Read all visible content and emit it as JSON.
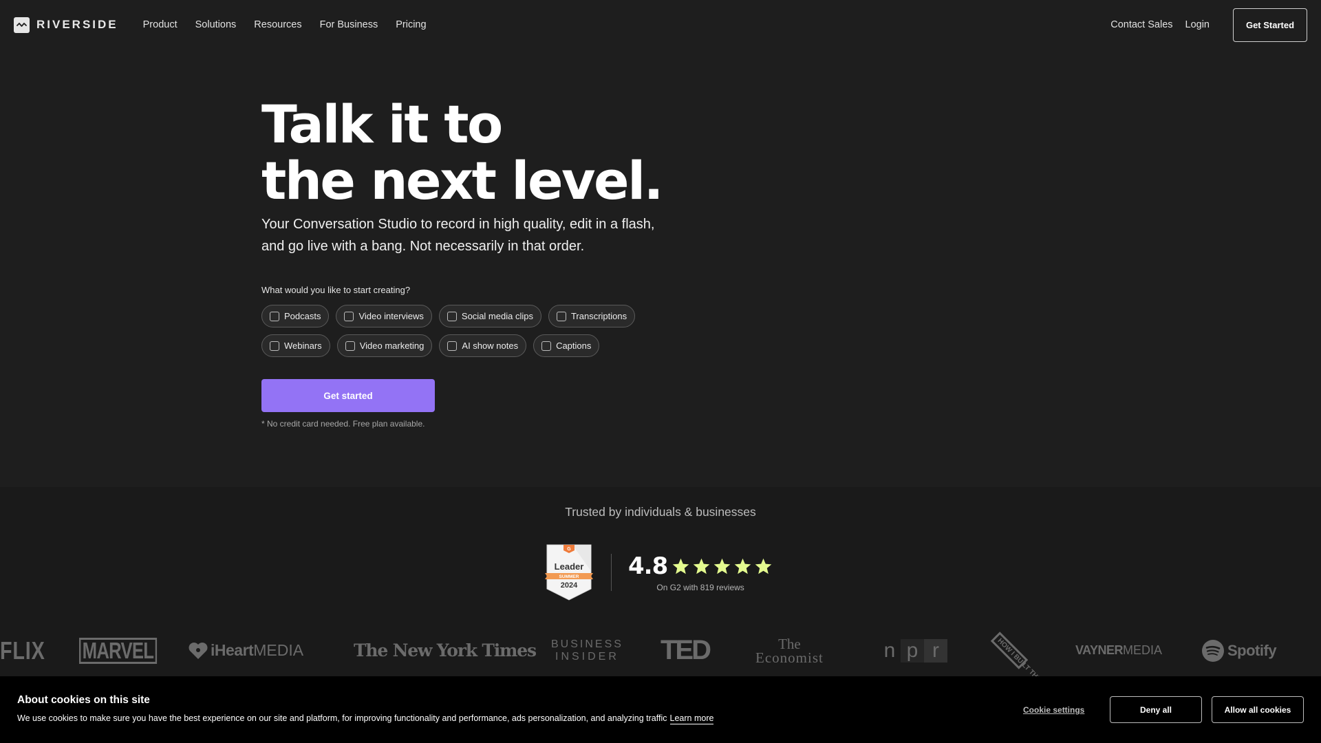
{
  "nav": {
    "brand": "RIVERSIDE",
    "links": [
      "Product",
      "Solutions",
      "Resources",
      "For Business",
      "Pricing"
    ],
    "contact_sales": "Contact Sales",
    "login": "Login",
    "get_started": "Get Started"
  },
  "hero": {
    "headline_line1": "Talk it to",
    "headline_line2": "the next level.",
    "subtitle_line1": "Your Conversation Studio to record in high quality, edit in a flash,",
    "subtitle_line2": "and go live with a bang. Not necessarily in that order.",
    "question": "What would you like to start creating?",
    "options_row1": [
      {
        "label": "Podcasts",
        "checked": false
      },
      {
        "label": "Video interviews",
        "checked": false
      },
      {
        "label": "Social media clips",
        "checked": false
      },
      {
        "label": "Transcriptions",
        "checked": false
      }
    ],
    "options_row2": [
      {
        "label": "Webinars",
        "checked": false
      },
      {
        "label": "Video marketing",
        "checked": false
      },
      {
        "label": "AI show notes",
        "checked": false
      },
      {
        "label": "Captions",
        "checked": false
      }
    ],
    "cta": "Get started",
    "note": "* No credit card needed. Free plan available.",
    "accent_color": "#9373f5"
  },
  "trust": {
    "title": "Trusted by individuals & businesses",
    "badge": {
      "brand": "G2",
      "title": "Leader",
      "season": "SUMMER",
      "year": "2024"
    },
    "rating": "4.8",
    "stars": 4.8,
    "star_color": "#e4fb8f",
    "reviews": "On G2 with 819 reviews",
    "logos": [
      "Netflix",
      "Marvel",
      "iHeartMEDIA",
      "The New York Times",
      "Business Insider",
      "TED",
      "The Economist",
      "npr",
      "How I Built This",
      "VaynerMedia",
      "Spotify"
    ]
  },
  "logo_text": {
    "netflix": "FLIX",
    "marvel": "MARVEL",
    "iheart_bold": "iHeart",
    "iheart_light": "MEDIA",
    "nyt": "The New York Times",
    "bi_line1": "BUSINESS",
    "bi_line2": "INSIDER",
    "ted": "TED",
    "economist_line1": "The",
    "economist_line2": "Economist",
    "npr": [
      "n",
      "p",
      "r"
    ],
    "hibt": "HOW I BUILT THIS",
    "vayner_bold": "VAYNER",
    "vayner_light": "MEDIA",
    "spotify": "Spotify"
  },
  "cookie": {
    "title": "About cookies on this site",
    "text": "We use cookies to make sure you have the best experience on our site and platform, for improving functionality and performance, ads personalization, and analyzing traffic",
    "learn_more": "Learn more",
    "settings": "Cookie settings",
    "deny": "Deny all",
    "allow": "Allow all cookies"
  }
}
